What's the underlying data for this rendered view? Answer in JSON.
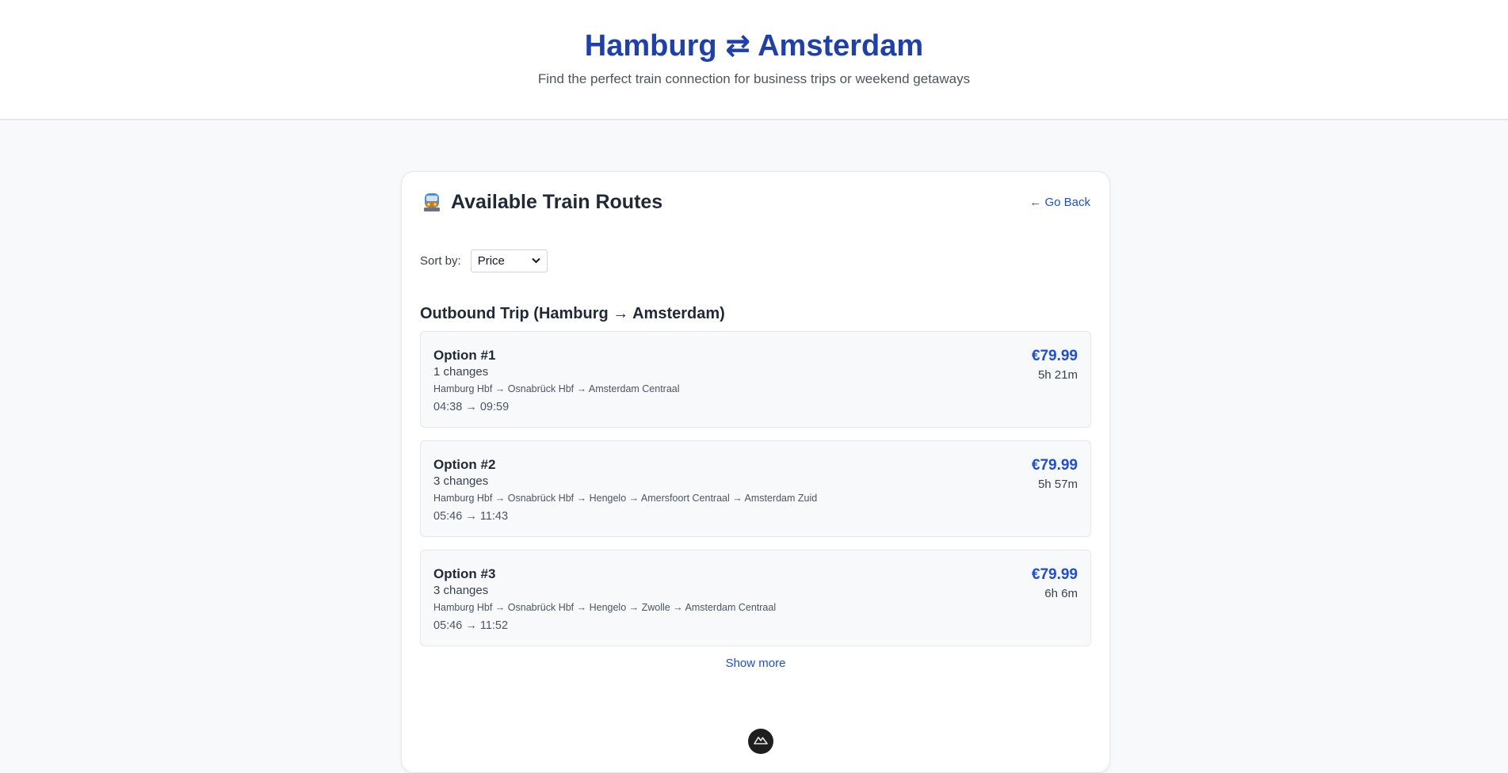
{
  "header": {
    "title": "Hamburg ⇄ Amsterdam",
    "subtitle": "Find the perfect train connection for business trips or weekend getaways"
  },
  "card": {
    "icon": "train-icon",
    "title": "Available Train Routes",
    "go_back": "← Go Back"
  },
  "sort": {
    "label": "Sort by:",
    "selected": "Price"
  },
  "section": {
    "title": "Outbound Trip (Hamburg → Amsterdam)"
  },
  "routes": [
    {
      "option": "Option #1",
      "changes": "1 changes",
      "path": "Hamburg Hbf → Osnabrück Hbf → Amsterdam Centraal",
      "times": "04:38 → 09:59",
      "price": "€79.99",
      "duration": "5h 21m"
    },
    {
      "option": "Option #2",
      "changes": "3 changes",
      "path": "Hamburg Hbf → Osnabrück Hbf → Hengelo → Amersfoort Centraal → Amsterdam Zuid",
      "times": "05:46 → 11:43",
      "price": "€79.99",
      "duration": "5h 57m"
    },
    {
      "option": "Option #3",
      "changes": "3 changes",
      "path": "Hamburg Hbf → Osnabrück Hbf → Hengelo → Zwolle → Amsterdam Centraal",
      "times": "05:46 → 11:52",
      "price": "€79.99",
      "duration": "6h 6m"
    }
  ],
  "show_more": "Show more",
  "fab": {
    "icon": "mountain-logo-icon"
  },
  "colors": {
    "accent": "#1d4ed8",
    "title": "#1e40af",
    "background": "#f8f9fb"
  }
}
